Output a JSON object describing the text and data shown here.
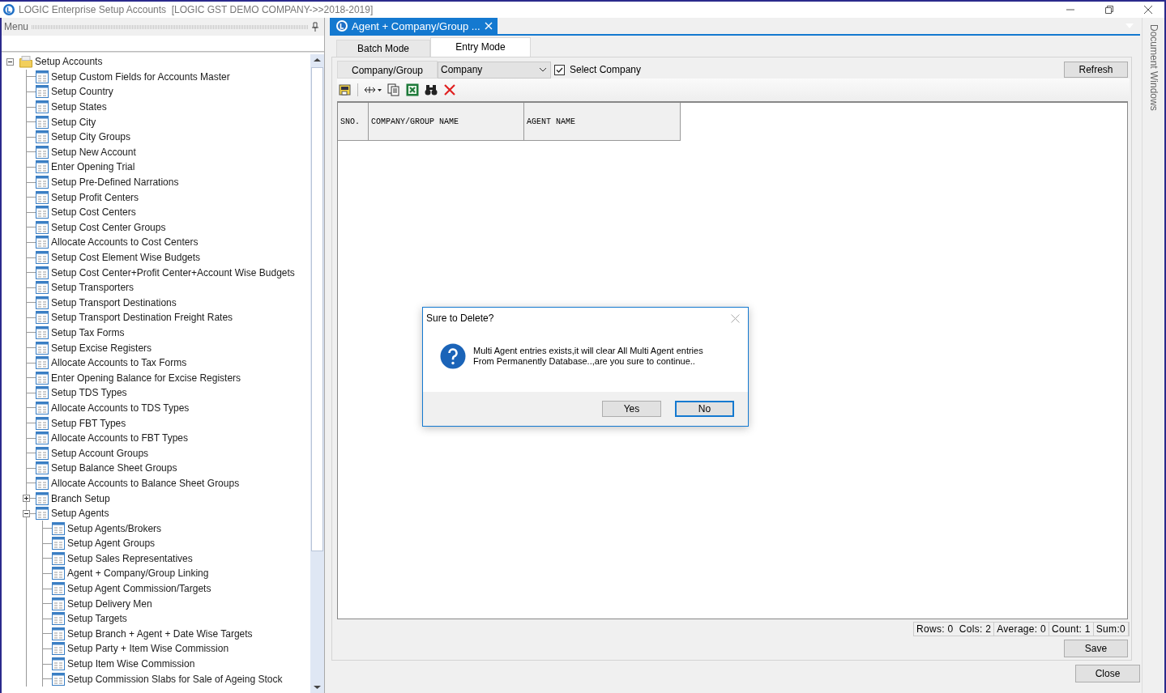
{
  "window": {
    "title": "LOGIC Enterprise Setup Accounts  [LOGIC GST DEMO COMPANY->>2018-2019]"
  },
  "menu_pane": {
    "title": "Menu",
    "tree": [
      {
        "label": "Setup Accounts",
        "kind": "folder",
        "expanded": true,
        "children": [
          {
            "label": "Setup Custom Fields for Accounts Master",
            "kind": "form"
          },
          {
            "label": "Setup Country",
            "kind": "form"
          },
          {
            "label": "Setup States",
            "kind": "form"
          },
          {
            "label": "Setup City",
            "kind": "form"
          },
          {
            "label": "Setup City Groups",
            "kind": "form"
          },
          {
            "label": "Setup New Account",
            "kind": "form"
          },
          {
            "label": "Enter Opening Trial",
            "kind": "form"
          },
          {
            "label": "Setup Pre-Defined Narrations",
            "kind": "form"
          },
          {
            "label": "Setup Profit Centers",
            "kind": "form"
          },
          {
            "label": "Setup Cost Centers",
            "kind": "form"
          },
          {
            "label": "Setup Cost Center Groups",
            "kind": "form"
          },
          {
            "label": "Allocate Accounts to Cost Centers",
            "kind": "form"
          },
          {
            "label": "Setup Cost Element Wise Budgets",
            "kind": "form"
          },
          {
            "label": "Setup Cost Center+Profit Center+Account Wise Budgets",
            "kind": "form"
          },
          {
            "label": "Setup Transporters",
            "kind": "form"
          },
          {
            "label": "Setup Transport Destinations",
            "kind": "form"
          },
          {
            "label": "Setup Transport Destination Freight Rates",
            "kind": "form"
          },
          {
            "label": "Setup Tax Forms",
            "kind": "form"
          },
          {
            "label": "Setup Excise Registers",
            "kind": "form"
          },
          {
            "label": "Allocate Accounts to Tax Forms",
            "kind": "form"
          },
          {
            "label": "Enter Opening Balance for Excise Registers",
            "kind": "form"
          },
          {
            "label": "Setup TDS Types",
            "kind": "form"
          },
          {
            "label": "Allocate Accounts to TDS Types",
            "kind": "form"
          },
          {
            "label": "Setup FBT Types",
            "kind": "form"
          },
          {
            "label": "Allocate Accounts to FBT Types",
            "kind": "form"
          },
          {
            "label": "Setup Account Groups",
            "kind": "form"
          },
          {
            "label": "Setup Balance Sheet Groups",
            "kind": "form"
          },
          {
            "label": "Allocate Accounts to Balance Sheet Groups",
            "kind": "form"
          },
          {
            "label": "Branch Setup",
            "kind": "form",
            "expanded": false
          },
          {
            "label": "Setup Agents",
            "kind": "form",
            "expanded": true,
            "children": [
              {
                "label": "Setup Agents/Brokers",
                "kind": "form"
              },
              {
                "label": "Setup Agent Groups",
                "kind": "form"
              },
              {
                "label": "Setup Sales Representatives",
                "kind": "form"
              },
              {
                "label": "Agent + Company/Group Linking",
                "kind": "form"
              },
              {
                "label": "Setup Agent Commission/Targets",
                "kind": "form"
              },
              {
                "label": "Setup Delivery Men",
                "kind": "form"
              },
              {
                "label": "Setup Targets",
                "kind": "form"
              },
              {
                "label": "Setup Branch + Agent + Date Wise Targets",
                "kind": "form"
              },
              {
                "label": "Setup Party + Item Wise Commission",
                "kind": "form"
              },
              {
                "label": "Setup Item Wise Commission",
                "kind": "form"
              },
              {
                "label": "Setup Commission Slabs for Sale of Ageing Stock",
                "kind": "form"
              }
            ]
          }
        ]
      }
    ]
  },
  "document_tab": {
    "title": "Agent + Company/Group ..."
  },
  "mode_tabs": [
    {
      "label": "Batch Mode",
      "selected": false
    },
    {
      "label": "Entry Mode",
      "selected": true
    }
  ],
  "filter": {
    "label": "Company/Group",
    "dropdown_value": "Company",
    "checkbox_label": "Select Company",
    "checked": true,
    "refresh": "Refresh"
  },
  "table": {
    "columns": [
      "SNO.",
      "COMPANY/GROUP NAME",
      "AGENT NAME"
    ]
  },
  "status_bar": [
    "Rows: 0  Cols: 2",
    "Average: 0",
    "Count: 1",
    "Sum:0"
  ],
  "save": "Save",
  "close": "Close",
  "side_panel": {
    "title": "Document Windows"
  },
  "dialog": {
    "title": "Sure to Delete?",
    "message": "Multi Agent entries exists,it will clear All Multi Agent entries\nFrom Permanently Database..,are you sure to continue..",
    "buttons": [
      {
        "label": "Yes",
        "selected": false
      },
      {
        "label": "No",
        "selected": true
      }
    ]
  }
}
